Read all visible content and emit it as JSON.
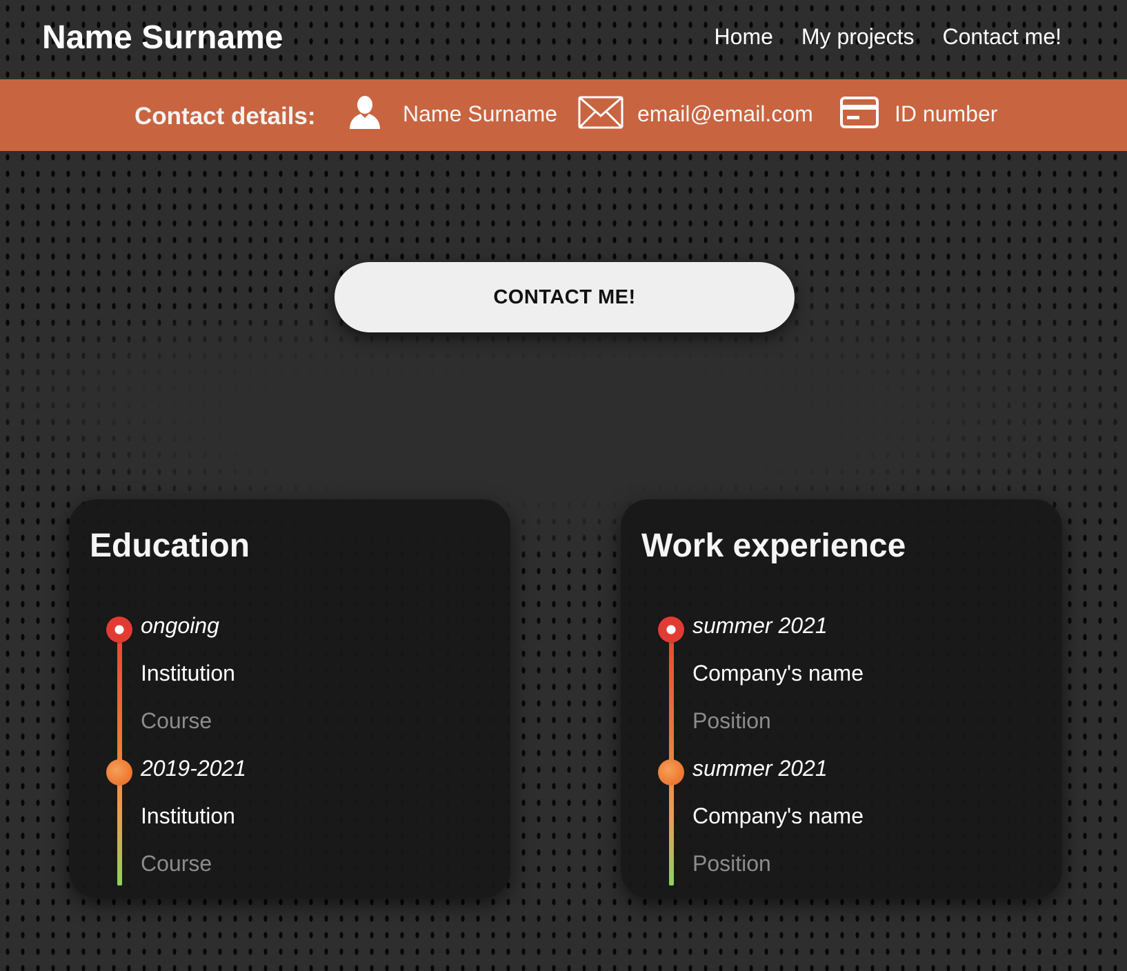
{
  "header": {
    "brand": "Name Surname",
    "nav": [
      "Home",
      "My projects",
      "Contact me!"
    ]
  },
  "contact": {
    "label": "Contact details:",
    "name": "Name Surname",
    "email": "email@email.com",
    "id": "ID number",
    "icons": [
      "user-icon",
      "envelope-icon",
      "id-card-icon"
    ]
  },
  "cta": {
    "label": "CONTACT ME!"
  },
  "education": {
    "title": "Education",
    "entries": [
      {
        "date": "ongoing",
        "institution": "Institution",
        "course": "Course"
      },
      {
        "date": "2019-2021",
        "institution": "Institution",
        "course": "Course"
      }
    ]
  },
  "work": {
    "title": "Work experience",
    "entries": [
      {
        "date": "summer 2021",
        "company": "Company's name",
        "position": "Position"
      },
      {
        "date": "summer 2021",
        "company": "Company's name",
        "position": "Position"
      }
    ]
  },
  "colors": {
    "accent": "#c96440",
    "background": "#2e2e2e",
    "card": "#181818",
    "timeline_start": "#e8433b",
    "timeline_end": "#8fd35e",
    "button": "#efefef"
  }
}
